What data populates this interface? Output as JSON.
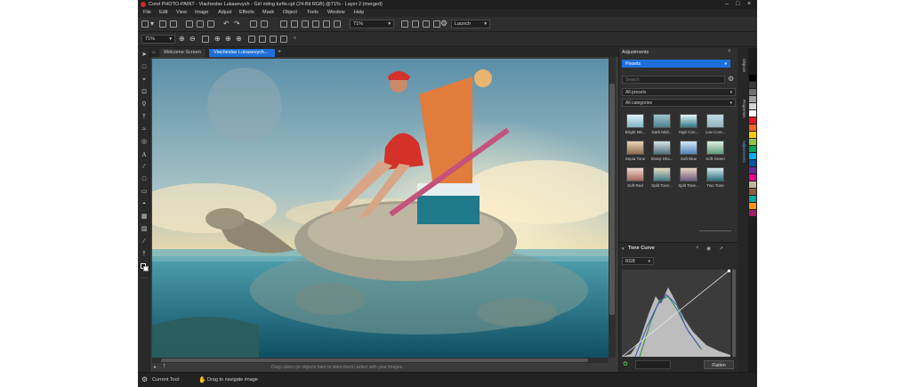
{
  "window": {
    "title": "Corel PHOTO-PAINT - Viacheslav Lukasevych - Girl riding turtle.cpt (24-Bit RGB) @71% - Layer 2 (merged)"
  },
  "menu": [
    "File",
    "Edit",
    "View",
    "Image",
    "Adjust",
    "Effects",
    "Mask",
    "Object",
    "Tools",
    "Window",
    "Help"
  ],
  "toolbar": {
    "zoom": "71%",
    "launch": "Launch"
  },
  "propbar": {
    "zoom": "71%"
  },
  "tabs": [
    {
      "label": "Welcome Screen",
      "active": false
    },
    {
      "label": "Viacheslav Lukasevych...",
      "active": true
    }
  ],
  "canvas": {
    "hint": "Drag colors (or objects here to store them) select with your images"
  },
  "status": {
    "current_tool": "Current Tool:",
    "hint": "Drag to navigate image"
  },
  "adjustments": {
    "title": "Adjustments",
    "mode": "Presets",
    "search_placeholder": "Search",
    "filter_presets": "All presets",
    "filter_categories": "All categories",
    "presets": [
      "Bright Mil...",
      "Dark Midt...",
      "High Con...",
      "Low Cont...",
      "Sepia Tone",
      "Sharp Sha...",
      "Soft Blue",
      "Soft Green",
      "Soft Red",
      "Split Tone...",
      "Split Tone...",
      "Two Tone"
    ],
    "tone_curve": {
      "title": "Tone Curve",
      "channel": "RGB",
      "flatten_label": "Flatten"
    }
  },
  "side_tabs": [
    "Objects",
    "Properties",
    "Adjustments"
  ],
  "colors": {
    "accent": "#1e6fd9",
    "palette": [
      "#000000",
      "#3a3a3a",
      "#6e6e6e",
      "#a0a0a0",
      "#d2d2d2",
      "#ffffff",
      "#e6162d",
      "#f26522",
      "#ffcc00",
      "#8dc63f",
      "#00a651",
      "#00aeef",
      "#0054a6",
      "#662d91",
      "#ec008c",
      "#c2b59b",
      "#8b5e3c",
      "#00a99d",
      "#f7941d",
      "#9e1f63"
    ]
  }
}
